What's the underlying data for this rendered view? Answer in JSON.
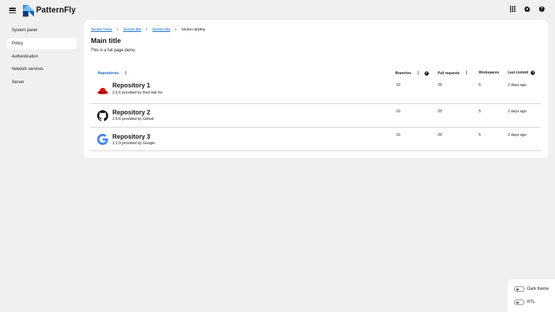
{
  "masthead": {
    "brand": "PatternFly",
    "icons": [
      "menu-icon",
      "grid-icon",
      "gear-icon",
      "help-icon"
    ]
  },
  "sidebar": {
    "items": [
      {
        "label": "System panel",
        "active": false
      },
      {
        "label": "Policy",
        "active": true
      },
      {
        "label": "Authentication",
        "active": false
      },
      {
        "label": "Network services",
        "active": false
      },
      {
        "label": "Server",
        "active": false
      }
    ]
  },
  "breadcrumb": {
    "items": [
      "Section home",
      "Section title",
      "Section title"
    ],
    "current": "Section landing"
  },
  "main": {
    "title": "Main title",
    "description": "This is a full page demo."
  },
  "table": {
    "headers": {
      "repositories": "Repositories",
      "branches": "Branches",
      "pull_requests": "Pull requests",
      "workspaces": "Workspaces",
      "last_commit": "Last commit"
    },
    "rows": [
      {
        "name": "Repository 1",
        "subtitle": "2.6.6 provided by Red Hat Inc",
        "icon": "redhat-icon",
        "branches": "10",
        "pull_requests": "25",
        "workspaces": "5",
        "last_commit": "2 days ago"
      },
      {
        "name": "Repository 2",
        "subtitle": "2.6.6 provided by Github",
        "icon": "github-icon",
        "branches": "10",
        "pull_requests": "25",
        "workspaces": "5",
        "last_commit": "2 days ago"
      },
      {
        "name": "Repository 3",
        "subtitle": "1.2.3 provided by Google",
        "icon": "google-icon",
        "branches": "10",
        "pull_requests": "25",
        "workspaces": "5",
        "last_commit": "2 days ago"
      }
    ]
  },
  "theme_toggles": {
    "dark_theme": "Dark theme",
    "rtl": "RTL"
  },
  "colors": {
    "link": "#0066cc",
    "background": "#f0f0f0",
    "card": "#ffffff",
    "text": "#151515"
  }
}
